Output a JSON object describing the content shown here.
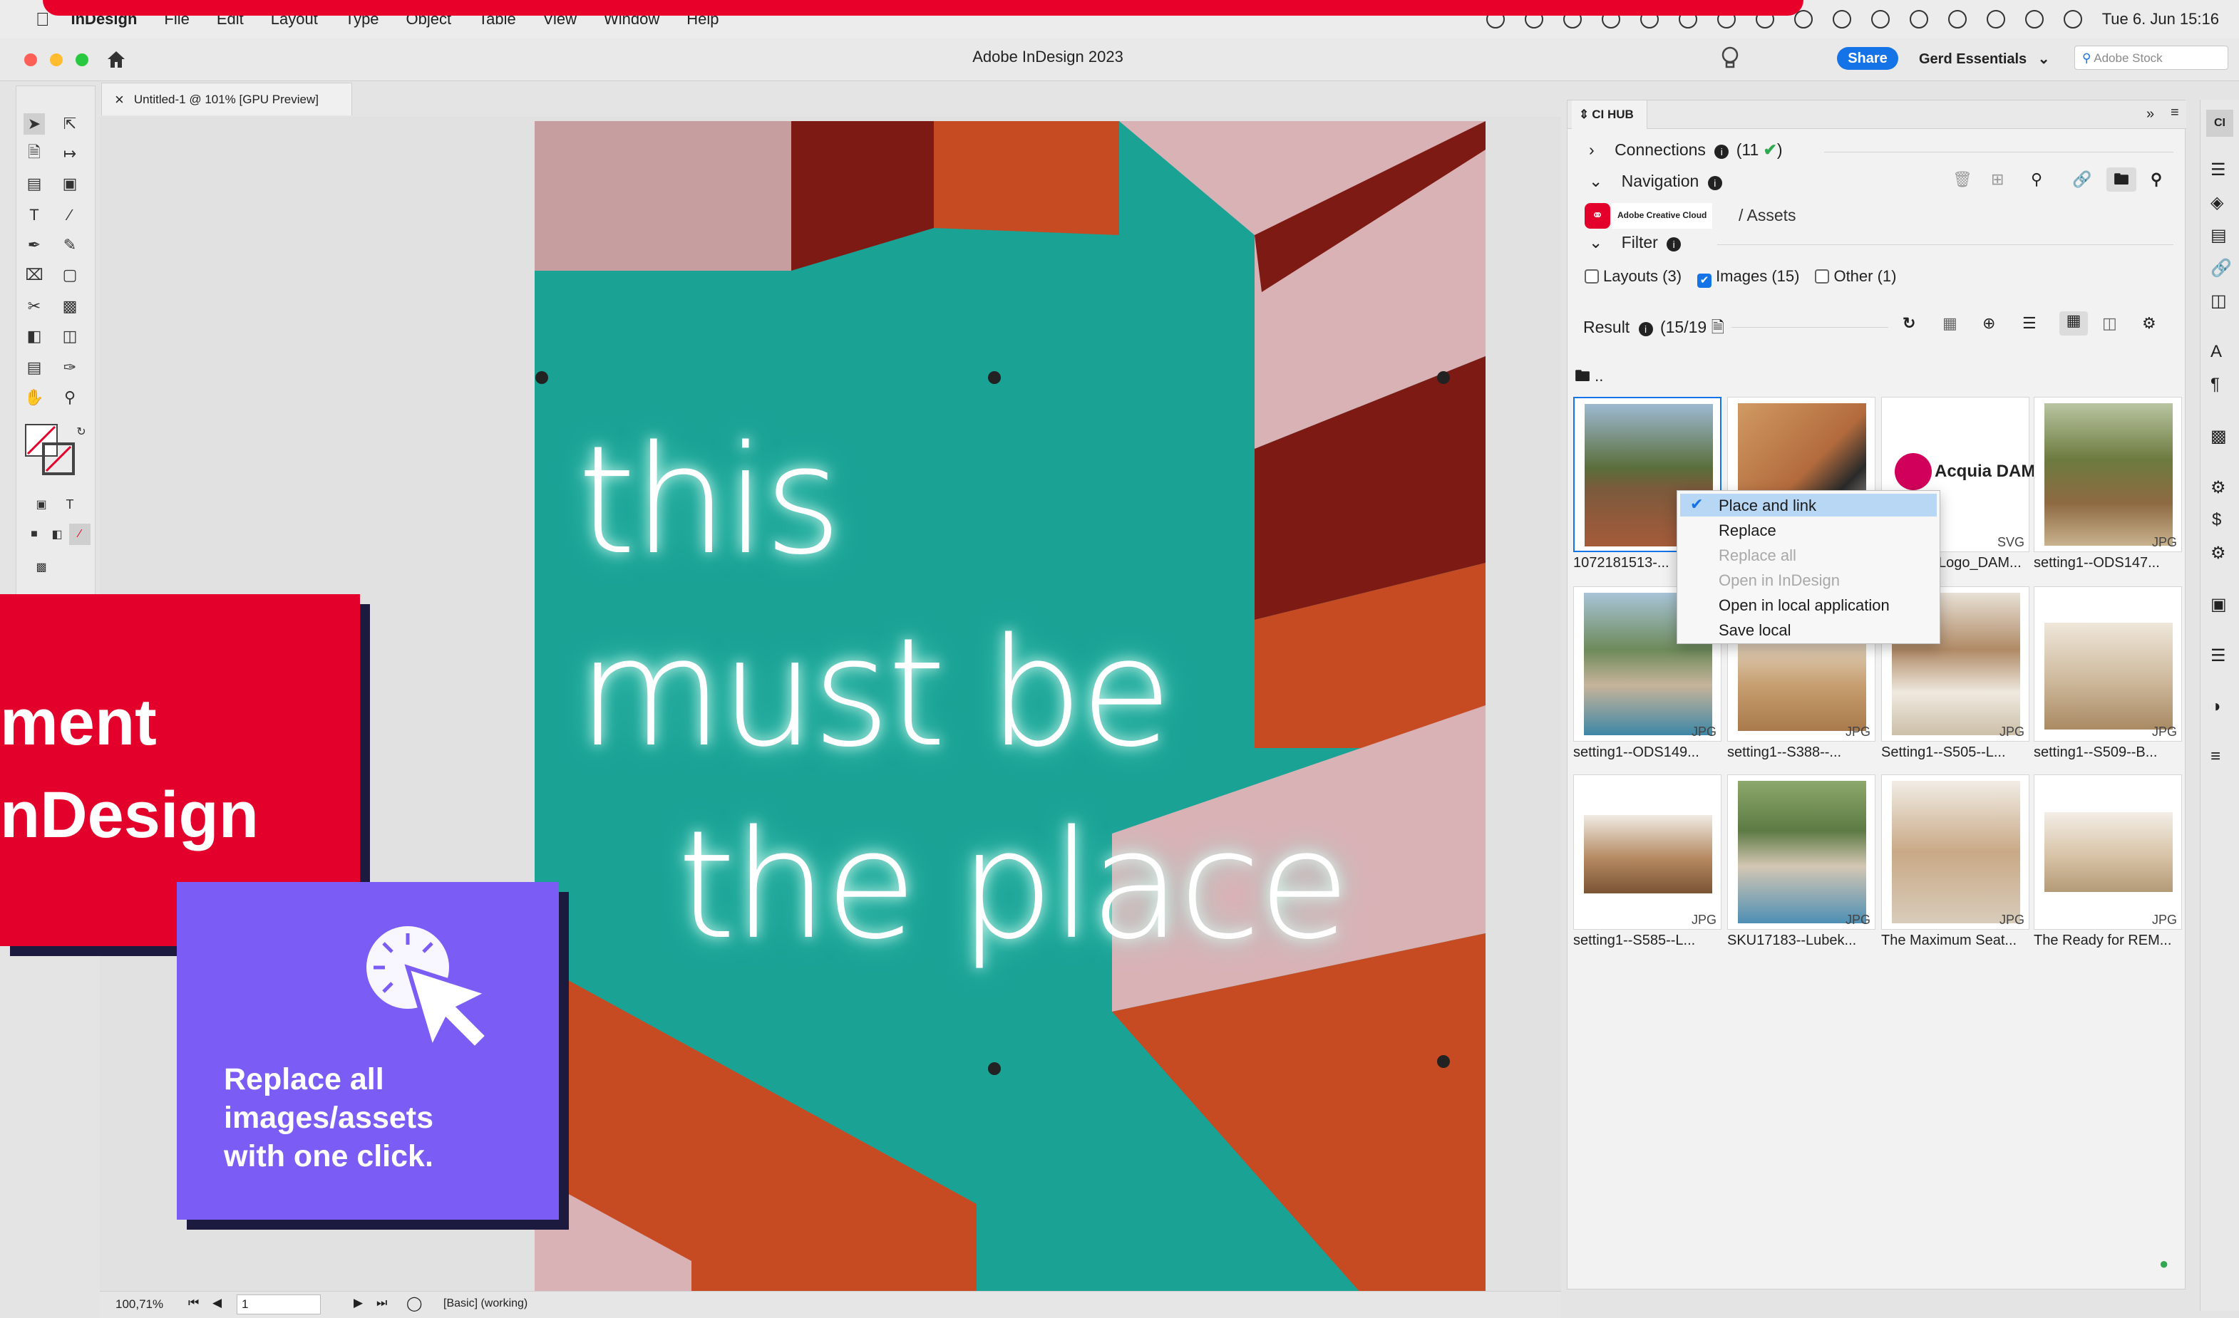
{
  "menubar": {
    "items": [
      "InDesign",
      "File",
      "Edit",
      "Layout",
      "Type",
      "Object",
      "Table",
      "View",
      "Window",
      "Help"
    ],
    "clock": "Tue 6. Jun  15:16"
  },
  "titlebar": {
    "title": "Adobe InDesign 2023",
    "share_label": "Share",
    "workspace": "Gerd Essentials",
    "search_placeholder": "Adobe Stock"
  },
  "document": {
    "tab_label": "Untitled-1 @ 101% [GPU Preview]",
    "tab_close": "×"
  },
  "canvas_text": {
    "line1": "this",
    "line2": "must be",
    "line3": "the place"
  },
  "overlay": {
    "red_line1": "ment",
    "red_line2": "nDesign",
    "purple_text": "Replace all images/assets with one click."
  },
  "cihub": {
    "panel_title": "CI HUB",
    "connections_label": "Connections",
    "connections_count": "(11",
    "navigation_label": "Navigation",
    "source_badge": "Adobe Creative Cloud",
    "breadcrumb": "/ Assets",
    "filter_label": "Filter",
    "filters": [
      {
        "label": "Layouts (3)",
        "checked": false
      },
      {
        "label": "Images (15)",
        "checked": true
      },
      {
        "label": "Other (1)",
        "checked": false
      }
    ],
    "result_label": "Result",
    "result_count": "(15/19",
    "folder_up": "..",
    "tiles": [
      {
        "name": "1072181513-...",
        "ext": "",
        "color": "#7d8b5a"
      },
      {
        "name": "",
        "ext": "",
        "color": "#c88a57"
      },
      {
        "name": "Logo_DAM...",
        "ext": "SVG",
        "color": "#ffffff"
      },
      {
        "name": "setting1--ODS147...",
        "ext": "JPG",
        "color": "#6c7a3f"
      },
      {
        "name": "setting1--ODS149...",
        "ext": "JPG",
        "color": "#5b8fa4"
      },
      {
        "name": "setting1--S388--...",
        "ext": "JPG",
        "color": "#c59d6e"
      },
      {
        "name": "Setting1--S505--L...",
        "ext": "JPG",
        "color": "#b08a66"
      },
      {
        "name": "setting1--S509--B...",
        "ext": "JPG",
        "color": "#cdb89b"
      },
      {
        "name": "setting1--S585--L...",
        "ext": "JPG",
        "color": "#b58a62"
      },
      {
        "name": "SKU17183--Lubek...",
        "ext": "JPG",
        "color": "#7c9a6b"
      },
      {
        "name": "The Maximum Seat...",
        "ext": "JPG",
        "color": "#c9a986"
      },
      {
        "name": "The Ready for REM...",
        "ext": "JPG",
        "color": "#d7c3a6"
      }
    ],
    "acquia_label": "Acquia DAM"
  },
  "context_menu": {
    "items": [
      {
        "label": "Place and link",
        "enabled": true,
        "checked": true
      },
      {
        "label": "Replace",
        "enabled": true,
        "checked": false
      },
      {
        "label": "Replace all",
        "enabled": false,
        "checked": false
      },
      {
        "label": "Open in InDesign",
        "enabled": false,
        "checked": false
      },
      {
        "label": "Open in local application",
        "enabled": true,
        "checked": false
      },
      {
        "label": "Save local",
        "enabled": true,
        "checked": false
      }
    ]
  },
  "statusbar": {
    "zoom": "100,71%",
    "page": "1",
    "preflight": "[Basic] (working)"
  },
  "colors": {
    "accent_red": "#e3002b",
    "accent_purple": "#7b5cf5",
    "share_blue": "#1473e6",
    "wall_teal": "#1aa295"
  }
}
